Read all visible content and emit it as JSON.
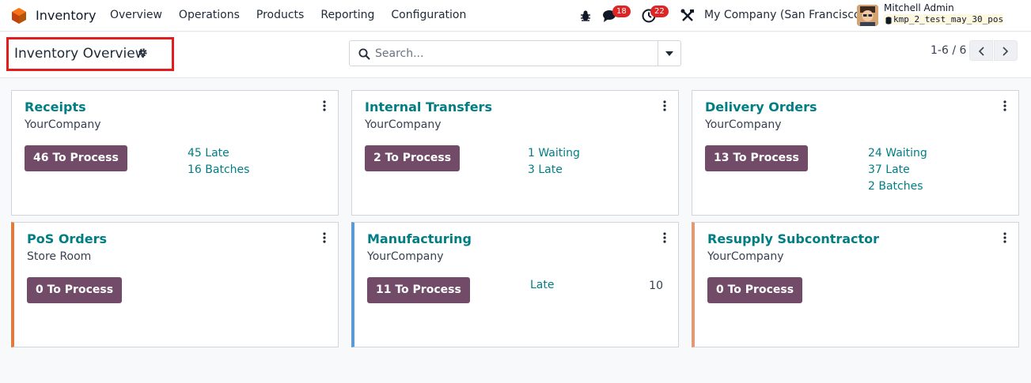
{
  "navbar": {
    "app_name": "Inventory",
    "menu": [
      "Overview",
      "Operations",
      "Products",
      "Reporting",
      "Configuration"
    ],
    "messages_count": "18",
    "activities_count": "22",
    "company": "My Company (San Francisco)",
    "user_name": "Mitchell Admin",
    "database": "kmp_2_test_may_30_pos",
    "icons": [
      "inventory-logo-icon",
      "bug-icon",
      "chat-icon",
      "clock-icon",
      "tools-icon",
      "database-icon"
    ]
  },
  "control": {
    "title": "Inventory Overview",
    "search_placeholder": "Search...",
    "pager": "1-6 / 6",
    "icons": [
      "gear-icon",
      "search-icon",
      "caret-down-icon",
      "chevron-left-icon",
      "chevron-right-icon"
    ]
  },
  "colors": {
    "brand": "#714b67",
    "link": "#017e84",
    "badge": "#dc2626",
    "highlight_box": "#e11d1d"
  },
  "cards": [
    {
      "title": "Receipts",
      "company": "YourCompany",
      "button": "46 To Process",
      "stats": [
        "45 Late",
        "16 Batches"
      ]
    },
    {
      "title": "Internal Transfers",
      "company": "YourCompany",
      "button": "2 To Process",
      "stats": [
        "1 Waiting",
        "3 Late"
      ]
    },
    {
      "title": "Delivery Orders",
      "company": "YourCompany",
      "button": "13 To Process",
      "stats": [
        "24 Waiting",
        "37 Late",
        "2 Batches"
      ]
    },
    {
      "title": "PoS Orders",
      "company": "Store Room",
      "button": "0 To Process",
      "stats": []
    },
    {
      "title": "Manufacturing",
      "company": "YourCompany",
      "button": "11 To Process",
      "stats": [
        "Late"
      ],
      "stat_value": "10"
    },
    {
      "title": "Resupply Subcontractor",
      "company": "YourCompany",
      "button": "0 To Process",
      "stats": []
    }
  ]
}
